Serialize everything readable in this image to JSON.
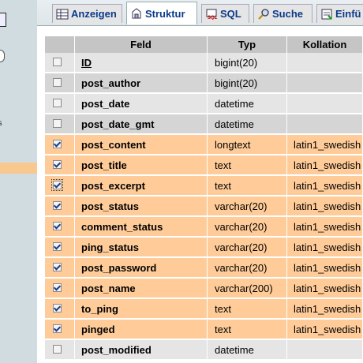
{
  "tabs": [
    {
      "label": "Anzeigen",
      "icon": "table-browse-icon"
    },
    {
      "label": "Struktur",
      "icon": "structure-icon",
      "active": true
    },
    {
      "label": "SQL",
      "icon": "sql-icon"
    },
    {
      "label": "Suche",
      "icon": "search-icon"
    },
    {
      "label": "Einfü",
      "icon": "insert-icon"
    }
  ],
  "sidebar": {
    "fragment_text": "ds"
  },
  "table": {
    "headers": [
      "Feld",
      "Typ",
      "Kollation"
    ],
    "rows": [
      {
        "field": "ID",
        "type": "bigint(20)",
        "collation": "",
        "checked": false
      },
      {
        "field": "post_author",
        "type": "bigint(20)",
        "collation": "",
        "checked": false
      },
      {
        "field": "post_date",
        "type": "datetime",
        "collation": "",
        "checked": false
      },
      {
        "field": "post_date_gmt",
        "type": "datetime",
        "collation": "",
        "checked": false
      },
      {
        "field": "post_content",
        "type": "longtext",
        "collation": "latin1_swedish",
        "checked": true
      },
      {
        "field": "post_title",
        "type": "text",
        "collation": "latin1_swedish",
        "checked": true
      },
      {
        "field": "post_excerpt",
        "type": "text",
        "collation": "latin1_swedish",
        "checked": true
      },
      {
        "field": "post_status",
        "type": "varchar(20)",
        "collation": "latin1_swedish",
        "checked": true
      },
      {
        "field": "comment_status",
        "type": "varchar(20)",
        "collation": "latin1_swedish",
        "checked": true
      },
      {
        "field": "ping_status",
        "type": "varchar(20)",
        "collation": "latin1_swedish",
        "checked": true
      },
      {
        "field": "post_password",
        "type": "varchar(20)",
        "collation": "latin1_swedish",
        "checked": true
      },
      {
        "field": "post_name",
        "type": "varchar(200)",
        "collation": "latin1_swedish",
        "checked": true
      },
      {
        "field": "to_ping",
        "type": "text",
        "collation": "latin1_swedish",
        "checked": true
      },
      {
        "field": "pinged",
        "type": "text",
        "collation": "latin1_swedish",
        "checked": true
      },
      {
        "field": "post_modified",
        "type": "datetime",
        "collation": "",
        "checked": false
      }
    ]
  },
  "colors": {
    "row_plain_a": "#e5e5e5",
    "row_plain_b": "#d5d5d5",
    "row_selected": "#ffcc99",
    "header_bg": "#c5c5c5",
    "tab_text": "#0a3a8a",
    "sidebar_bg": "#d0dce0",
    "sidebar_highlight": "#f9c88f"
  }
}
